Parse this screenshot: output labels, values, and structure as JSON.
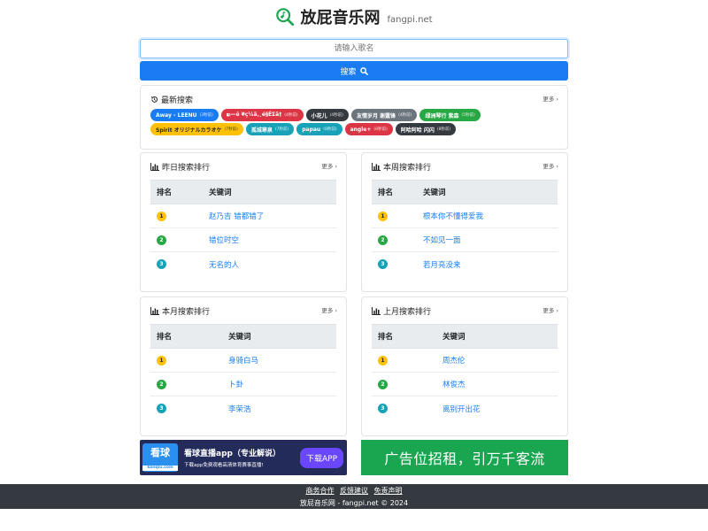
{
  "header": {
    "title": "放屁音乐网",
    "domain": "fangpi.net"
  },
  "search": {
    "placeholder": "请输入歌名",
    "button_label": "搜索"
  },
  "recent": {
    "title": "最新搜索",
    "more": "更多",
    "tags": [
      {
        "text": "Away - LEENU",
        "count": "(3秒前)",
        "color": "#1a7cf2"
      },
      {
        "text": "ఖ—ë ¥ç¼ã‚¸é§ÉΣã†",
        "count": "(4秒前)",
        "color": "#dc3545"
      },
      {
        "text": "小花儿",
        "count": "(4秒前)",
        "color": "#343a40"
      },
      {
        "text": "友情岁月 谢霆锋",
        "count": "(4秒前)",
        "color": "#6c757d"
      },
      {
        "text": "绿洲琴行 紫森",
        "count": "(5秒前)",
        "color": "#28a745"
      },
      {
        "text": "Spirit オリジナルカラオケ",
        "count": "(7秒前)",
        "color": "#ffc107"
      },
      {
        "text": "孤城寒泉",
        "count": "(7秒前)",
        "color": "#17a2b8"
      },
      {
        "text": "papau",
        "count": "(8秒前)",
        "color": "#17a2b8"
      },
      {
        "text": "angle+",
        "count": "(8秒前)",
        "color": "#dc3545"
      },
      {
        "text": "阿哈阿哈 闪闪",
        "count": "(8秒前)",
        "color": "#343a40"
      }
    ]
  },
  "rank_header": {
    "rank": "排名",
    "keyword": "关键词"
  },
  "rank_colors": [
    "#ffc107",
    "#28a745",
    "#17a2b8"
  ],
  "panels": [
    {
      "title": "昨日搜索排行",
      "more": "更多",
      "rows": [
        {
          "rank": "1",
          "keyword": "赵乃吉 错都错了"
        },
        {
          "rank": "2",
          "keyword": "错位时空"
        },
        {
          "rank": "3",
          "keyword": "无名的人"
        }
      ]
    },
    {
      "title": "本周搜索排行",
      "more": "更多",
      "rows": [
        {
          "rank": "1",
          "keyword": "根本你不懂得爱我"
        },
        {
          "rank": "2",
          "keyword": "不如见一面"
        },
        {
          "rank": "3",
          "keyword": "若月亮没来"
        }
      ]
    },
    {
      "title": "本月搜索排行",
      "more": "更多",
      "rows": [
        {
          "rank": "1",
          "keyword": "身骑白马"
        },
        {
          "rank": "2",
          "keyword": "卜卦"
        },
        {
          "rank": "3",
          "keyword": "李荣浩"
        }
      ]
    },
    {
      "title": "上月搜索排行",
      "more": "更多",
      "rows": [
        {
          "rank": "1",
          "keyword": "周杰伦"
        },
        {
          "rank": "2",
          "keyword": "林俊杰"
        },
        {
          "rank": "3",
          "keyword": "离别开出花"
        }
      ]
    }
  ],
  "ads": {
    "left": {
      "logo": "看球",
      "logo_sub": "kanqiu.com",
      "title": "看球直播app（专业解说）",
      "subtitle": "下载app免费观看高清体育赛事直播!",
      "button": "下载APP"
    },
    "right": {
      "text": "广告位招租，引万千客流"
    }
  },
  "footer": {
    "links": [
      "商务合作",
      "反馈建议",
      "免责声明"
    ],
    "copyright": "放屁音乐网 - fangpi.net © 2024"
  }
}
